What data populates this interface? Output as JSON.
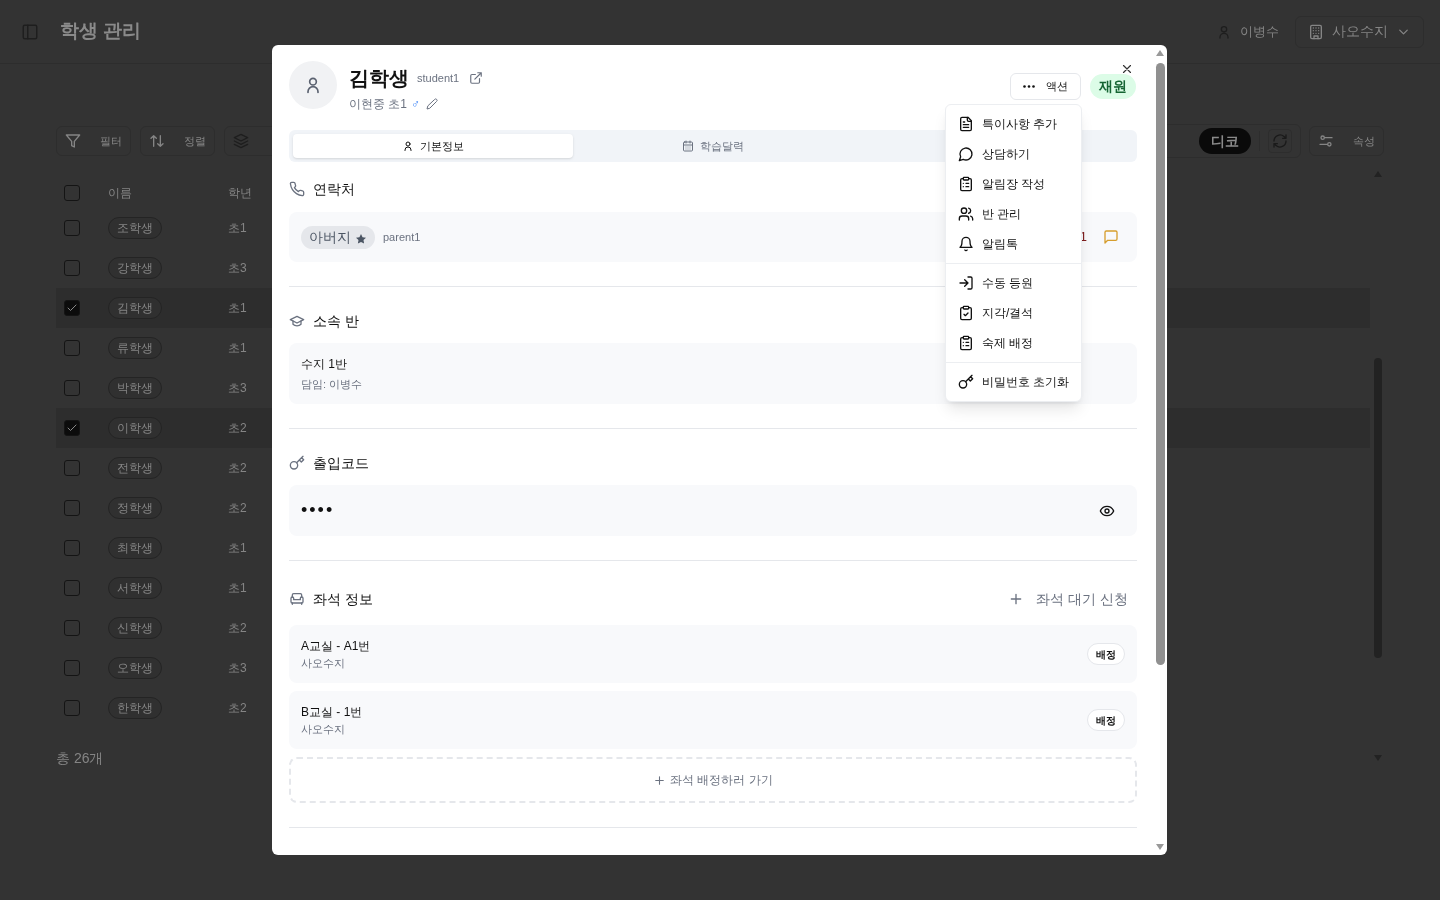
{
  "header": {
    "title": "학생 관리",
    "user_name": "이병수",
    "organization": "사오수지"
  },
  "toolbar": {
    "buttons": [
      "필터",
      "정렬"
    ],
    "tag": "디코",
    "settings_button": "속성"
  },
  "table": {
    "columns": [
      "이름",
      "학년"
    ],
    "all_checked": false,
    "rows": [
      {
        "name": "조학생",
        "grade": "초1",
        "checked": false
      },
      {
        "name": "강학생",
        "grade": "초3",
        "checked": false
      },
      {
        "name": "김학생",
        "grade": "초1",
        "checked": true
      },
      {
        "name": "류학생",
        "grade": "초1",
        "checked": false
      },
      {
        "name": "박학생",
        "grade": "초3",
        "checked": false
      },
      {
        "name": "이학생",
        "grade": "초2",
        "checked": true
      },
      {
        "name": "전학생",
        "grade": "초2",
        "checked": false
      },
      {
        "name": "정학생",
        "grade": "초2",
        "checked": false
      },
      {
        "name": "최학생",
        "grade": "초1",
        "checked": false
      },
      {
        "name": "서학생",
        "grade": "초1",
        "checked": false
      },
      {
        "name": "신학생",
        "grade": "초2",
        "checked": false
      },
      {
        "name": "오학생",
        "grade": "초3",
        "checked": false
      },
      {
        "name": "한학생",
        "grade": "초2",
        "checked": false
      }
    ],
    "total": "총 26개"
  },
  "modal": {
    "name": "김학생",
    "username": "student1",
    "school_grade": "이현중 초1",
    "gender": "♂",
    "actions_button": "액션",
    "status": "재원",
    "tabs": [
      {
        "label": "기본정보",
        "selected": true
      },
      {
        "label": "학습달력",
        "selected": false
      }
    ],
    "contact": {
      "title": "연락처",
      "relation": "아버지",
      "primary": true,
      "account": "parent1",
      "count": "1"
    },
    "class": {
      "title": "소속 반",
      "name": "수지 1반",
      "teacher": "담임: 이병수"
    },
    "access_code": {
      "title": "출입코드",
      "value": "••••"
    },
    "seats": {
      "title": "좌석 정보",
      "request_button": "좌석 대기 신청",
      "items": [
        {
          "room": "A교실 - A1번",
          "branch": "사오수지",
          "status": "배정"
        },
        {
          "room": "B교실 - 1번",
          "branch": "사오수지",
          "status": "배정"
        }
      ],
      "assign_button": "좌석 배정하러 가기"
    }
  },
  "action_menu": {
    "groups": [
      [
        "특이사항 추가",
        "상담하기",
        "알림장 작성",
        "반 관리",
        "알림톡"
      ],
      [
        "수동 등원",
        "지각/결석",
        "숙제 배정"
      ],
      [
        "비밀번호 초기화"
      ]
    ]
  }
}
